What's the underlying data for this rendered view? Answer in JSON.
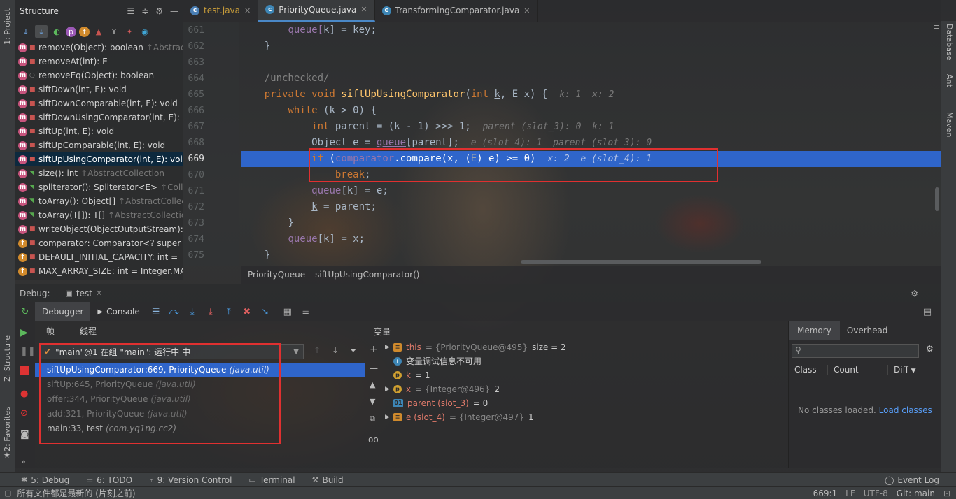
{
  "left_strip": {
    "project": "1: Project",
    "structure": "Z: Structure",
    "favorites": "2: Favorites"
  },
  "right_strip": {
    "database": "Database",
    "ant": "Ant",
    "maven": "Maven"
  },
  "structure": {
    "title": "Structure",
    "items": [
      {
        "icon": "m",
        "lock": "red",
        "text": "remove(Object): boolean",
        "extra": "↑Abstract"
      },
      {
        "icon": "m",
        "lock": "red",
        "text": "removeAt(int): E",
        "extra": ""
      },
      {
        "icon": "m",
        "lock": "none",
        "text": "removeEq(Object): boolean",
        "extra": ""
      },
      {
        "icon": "m",
        "lock": "red",
        "text": "siftDown(int, E): void",
        "extra": ""
      },
      {
        "icon": "m",
        "lock": "red",
        "text": "siftDownComparable(int, E): void",
        "extra": ""
      },
      {
        "icon": "m",
        "lock": "red",
        "text": "siftDownUsingComparator(int, E): v",
        "extra": ""
      },
      {
        "icon": "m",
        "lock": "red",
        "text": "siftUp(int, E): void",
        "extra": ""
      },
      {
        "icon": "m",
        "lock": "red",
        "text": "siftUpComparable(int, E): void",
        "extra": ""
      },
      {
        "icon": "m",
        "lock": "red",
        "text": "siftUpUsingComparator(int, E): void",
        "extra": "",
        "selected": true
      },
      {
        "icon": "m",
        "lock": "green",
        "text": "size(): int",
        "extra": "↑AbstractCollection"
      },
      {
        "icon": "m",
        "lock": "green",
        "text": "spliterator(): Spliterator<E>",
        "extra": "↑Colle"
      },
      {
        "icon": "m",
        "lock": "green",
        "text": "toArray(): Object[]",
        "extra": "↑AbstractCollect"
      },
      {
        "icon": "m",
        "lock": "green",
        "text": "toArray(T[]): T[]",
        "extra": "↑AbstractCollection"
      },
      {
        "icon": "m",
        "lock": "red",
        "text": "writeObject(ObjectOutputStream): v",
        "extra": ""
      },
      {
        "icon": "f",
        "lock": "red",
        "text": "comparator: Comparator<? super",
        "extra": ""
      },
      {
        "icon": "f",
        "lock": "red",
        "text": "DEFAULT_INITIAL_CAPACITY: int =",
        "extra": ""
      },
      {
        "icon": "f",
        "lock": "red",
        "text": "MAX_ARRAY_SIZE: int = Integer.MA",
        "extra": ""
      }
    ]
  },
  "tabs": [
    {
      "label": "test.java",
      "active": false
    },
    {
      "label": "PriorityQueue.java",
      "active": true
    },
    {
      "label": "TransformingComparator.java",
      "active": false
    }
  ],
  "editor": {
    "lines": [
      "661",
      "662",
      "663",
      "664",
      "665",
      "666",
      "667",
      "668",
      "669",
      "670",
      "671",
      "672",
      "673",
      "674",
      "675"
    ],
    "code": {
      "l661a": "queue[",
      "l661b": "k",
      "l661c": "] = key;",
      "l662": "}",
      "l664": "/unchecked/",
      "l665kw": "private void ",
      "l665fn": "siftUpUsingComparator",
      "l665a": "(",
      "l665kw2": "int ",
      "l665k": "k",
      "l665b": ", E x) {",
      "l665h": "k: 1  x: 2",
      "l666kw": "while ",
      "l666a": "(k > 0) {",
      "l667kw": "int ",
      "l667a": "parent = (k - 1) >>> 1;",
      "l667h": "parent (slot_3): 0  k: 1",
      "l668a": "Object e = ",
      "l668f": "queue",
      "l668b": "[parent];",
      "l668h": "e (slot_4): 1  parent (slot_3): 0",
      "l669kw": "if ",
      "l669a": "(",
      "l669f": "comparator",
      "l669b": ".compare(x, (",
      "l669e": "E",
      "l669c": ") e) >= 0)",
      "l669h": "x: 2  e (slot_4): 1",
      "l670kw": "break",
      "l670b": ";",
      "l671f": "queue",
      "l671a": "[k] = e;",
      "l672k": "k",
      "l672a": " = parent;",
      "l673": "}",
      "l674f": "queue",
      "l674a": "[",
      "l674k": "k",
      "l674b": "] = x;",
      "l675": "}"
    }
  },
  "breadcrumb": [
    "PriorityQueue",
    "siftUpUsingComparator()"
  ],
  "debug": {
    "label": "Debug:",
    "run_tab": "test",
    "debugger_tab": "Debugger",
    "console_tab": "Console",
    "frames_tab": "帧",
    "threads_tab": "线程",
    "variables_title": "变量",
    "thread_value": "\"main\"@1 在组 \"main\": 运行中 中",
    "frames": [
      {
        "method": "siftUpUsingComparator:669, PriorityQueue",
        "pkg": "(java.util)",
        "selected": true,
        "lib": false
      },
      {
        "method": "siftUp:645, PriorityQueue",
        "pkg": "(java.util)",
        "selected": false,
        "lib": true
      },
      {
        "method": "offer:344, PriorityQueue",
        "pkg": "(java.util)",
        "selected": false,
        "lib": true
      },
      {
        "method": "add:321, PriorityQueue",
        "pkg": "(java.util)",
        "selected": false,
        "lib": true
      },
      {
        "method": "main:33, test",
        "pkg": "(com.yq1ng.cc2)",
        "selected": false,
        "lib": false
      }
    ],
    "variables": [
      {
        "name": "this",
        "val": "= {PriorityQueue@495}",
        "extra": "size = 2",
        "icon": "eq",
        "expand": true
      },
      {
        "name": "",
        "val": "变量调试信息不可用",
        "extra": "",
        "icon": "info",
        "expand": false
      },
      {
        "name": "k",
        "val": "= 1",
        "extra": "",
        "icon": "p",
        "expand": false
      },
      {
        "name": "x",
        "val": "= {Integer@496}",
        "extra": "2",
        "icon": "p",
        "expand": true
      },
      {
        "name": "parent (slot_3)",
        "val": "= 0",
        "extra": "",
        "icon": "01",
        "expand": false
      },
      {
        "name": "e (slot_4)",
        "val": "= {Integer@497}",
        "extra": "1",
        "icon": "eq",
        "expand": true
      }
    ],
    "memory": {
      "tab_memory": "Memory",
      "tab_overhead": "Overhead",
      "col_class": "Class",
      "col_count": "Count",
      "col_diff": "Diff",
      "empty": "No classes loaded.",
      "load": "Load classes"
    }
  },
  "bottom_tabs": [
    {
      "num": "5",
      "label": ": Debug"
    },
    {
      "num": "6",
      "label": ": TODO"
    },
    {
      "num": "9",
      "label": ": Version Control"
    },
    {
      "num": "",
      "label": "Terminal"
    },
    {
      "num": "",
      "label": "Build"
    }
  ],
  "event_log": "Event Log",
  "status": {
    "message": "所有文件都是最新的 (片刻之前)",
    "position": "669:1",
    "line_sep": "LF",
    "encoding": "UTF-8",
    "git": "Git: main"
  },
  "colors": {
    "accent": "#2f65ca",
    "highlight_box": "#e03030"
  }
}
